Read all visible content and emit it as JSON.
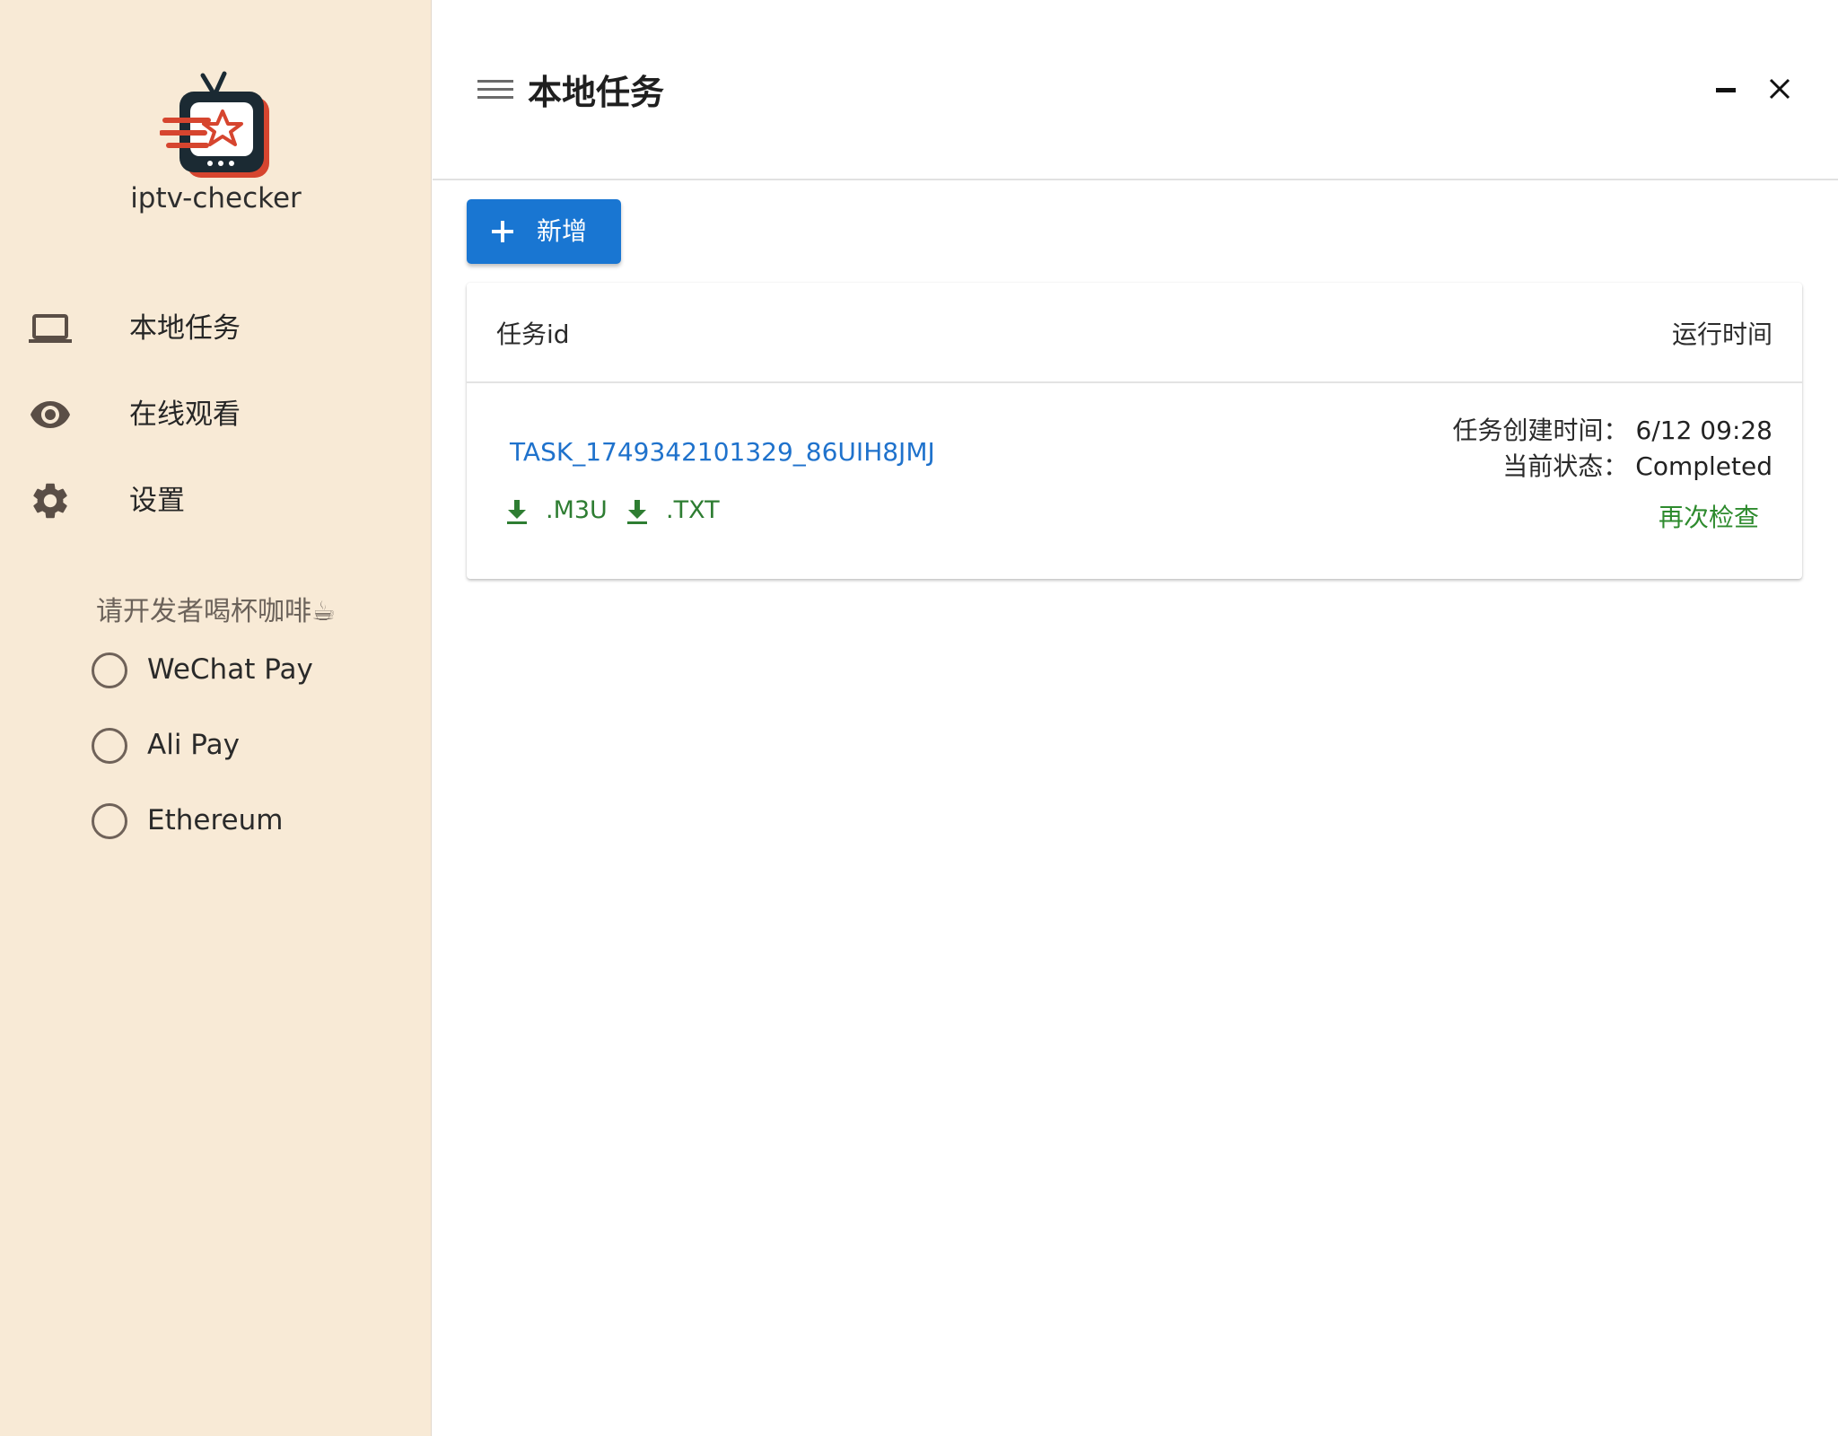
{
  "app": {
    "name": "iptv-checker",
    "logo_icon": "retro-tv-star-logo"
  },
  "sidebar": {
    "nav": [
      {
        "label": "本地任务",
        "icon": "laptop-icon"
      },
      {
        "label": "在线观看",
        "icon": "eye-icon"
      },
      {
        "label": "设置",
        "icon": "gear-icon"
      }
    ],
    "coffee": {
      "title": "请开发者喝杯咖啡☕",
      "options": [
        {
          "label": "WeChat Pay",
          "selected": false
        },
        {
          "label": "Ali Pay",
          "selected": false
        },
        {
          "label": "Ethereum",
          "selected": false
        }
      ]
    }
  },
  "header": {
    "title": "本地任务"
  },
  "toolbar": {
    "add_label": "新增"
  },
  "table": {
    "columns": {
      "left": "任务id",
      "right": "运行时间"
    },
    "rows": [
      {
        "task_id": "TASK_1749342101329_86UIH8JMJ",
        "downloads": [
          ".M3U",
          ".TXT"
        ],
        "created_label": "任务创建时间：",
        "created_value": "6/12 09:28",
        "status_label": "当前状态：",
        "status_value": "Completed",
        "recheck_label": "再次检查"
      }
    ]
  },
  "colors": {
    "sidebar_bg": "#f8ead6",
    "primary": "#1976d2",
    "link": "#1f72cc",
    "success": "#2e7d32"
  }
}
